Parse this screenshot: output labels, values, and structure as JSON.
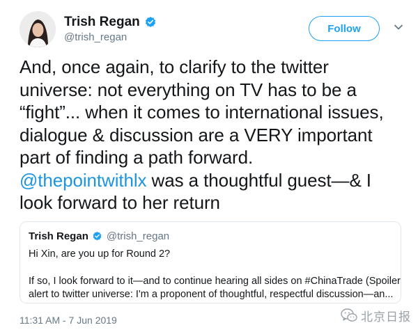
{
  "author": {
    "display_name": "Trish Regan",
    "handle": "@trish_regan",
    "verified": true
  },
  "follow_button": {
    "label": "Follow"
  },
  "tweet": {
    "lines": [
      "And, once again, to clarify to the twitter",
      "universe: not everything on TV has to be a",
      "“fight”... when it comes to international issues,",
      "dialogue & discussion are a VERY important",
      "part of finding a path forward."
    ],
    "mention": "@thepointwithlx",
    "line6_rest": " was a thoughtful guest—& I",
    "line7": "look forward to her return"
  },
  "quoted_tweet": {
    "display_name": "Trish Regan",
    "handle": "@trish_regan",
    "line1": "Hi Xin, are you up for Round 2?",
    "line2": "If so, I look forward to it—and to continue hearing all sides on #ChinaTrade (Spoiler",
    "line3": "alert to twitter universe: I'm a proponent of thoughtful, respectful discussion—an..."
  },
  "timestamp": "11:31 AM - 7 Jun 2019",
  "watermark": {
    "text": "北京日报"
  },
  "colors": {
    "accent": "#1da1f2",
    "mention": "#1b95e0",
    "secondary_text": "#657786",
    "border": "#e1e8ed"
  },
  "icons": {
    "verified": "verified-badge-icon",
    "menu": "chevron-down-icon",
    "watermark": "wechat-logo-icon"
  }
}
